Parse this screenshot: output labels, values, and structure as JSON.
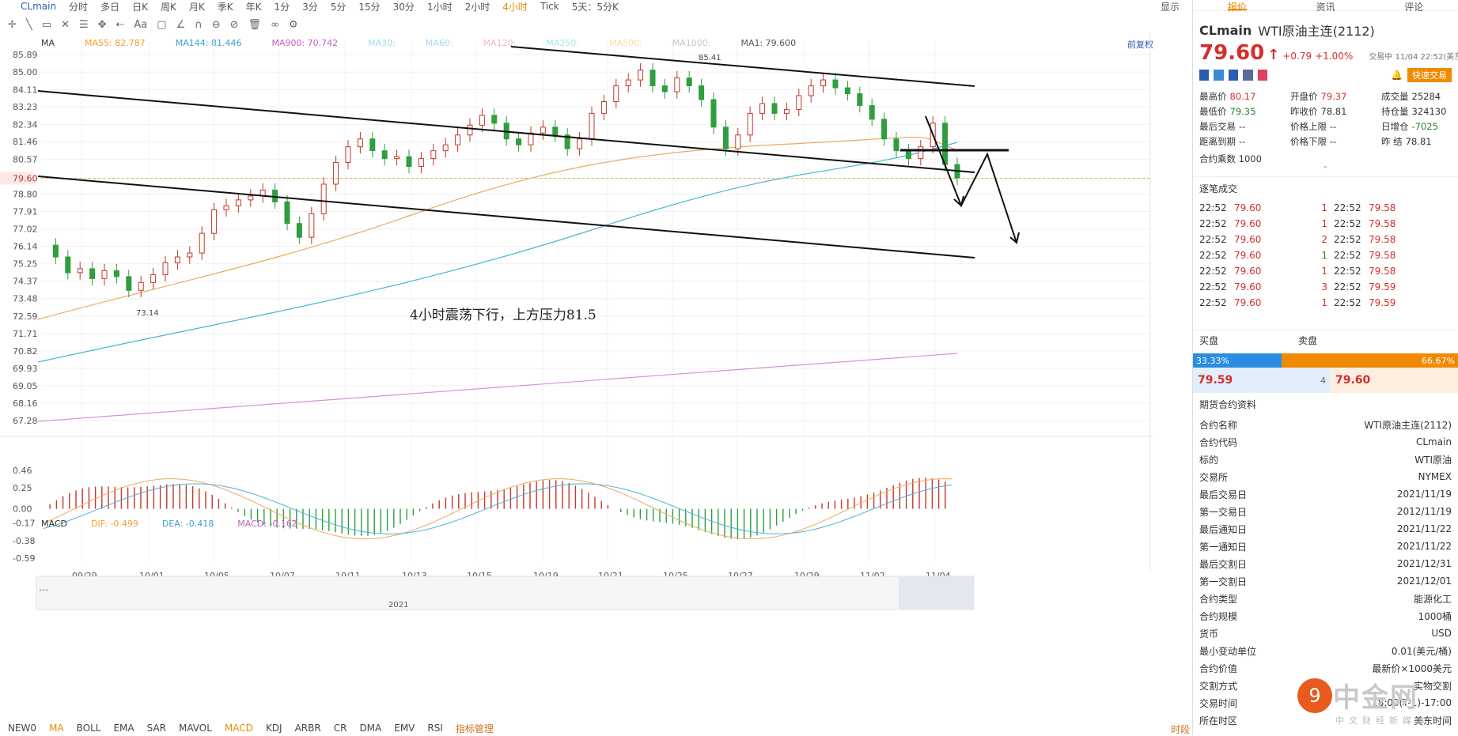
{
  "topbar": {
    "symbol": "CLmain",
    "periods": [
      "分时",
      "多日",
      "日K",
      "周K",
      "月K",
      "季K",
      "年K",
      "1分",
      "3分",
      "5分",
      "15分",
      "30分",
      "1小时",
      "2小时",
      "4小时",
      "Tick",
      "5天：5分K"
    ],
    "active_period": "4小时",
    "display": "显示"
  },
  "ma": {
    "label": "MA",
    "items": [
      {
        "text": "MA55: 82.787",
        "color": "#f0a030"
      },
      {
        "text": "MA144: 81.446",
        "color": "#3aa0d0"
      },
      {
        "text": "MA900: 70.742",
        "color": "#c060c0"
      },
      {
        "text": "MA30:",
        "color": "#a8d8e8"
      },
      {
        "text": "MA60:",
        "color": "#a8d8e8"
      },
      {
        "text": "MA120:",
        "color": "#f0b8c8"
      },
      {
        "text": "MA250:",
        "color": "#a8e8e8"
      },
      {
        "text": "MA500:",
        "color": "#f0e0a0"
      },
      {
        "text": "MA1000:",
        "color": "#c8c8c8"
      },
      {
        "text": "MA1: 79.600",
        "color": "#555555"
      }
    ],
    "adjust": "前复权"
  },
  "price_axis": [
    "85.89",
    "85.00",
    "84.11",
    "83.23",
    "82.34",
    "81.46",
    "80.57",
    "79.60",
    "78.80",
    "77.91",
    "77.02",
    "76.14",
    "75.25",
    "74.37",
    "73.48",
    "72.59",
    "71.71",
    "70.82",
    "69.93",
    "69.05",
    "68.16",
    "67.28"
  ],
  "current_price_label": "79.60",
  "annotations": {
    "high": "85.41",
    "low": "73.14",
    "comment": "4小时震荡下行，上方压力81.5"
  },
  "macd": {
    "label": "MACD",
    "dif": "DIF: -0.499",
    "dea": "DEA: -0.418",
    "macd": "MACD: -0.162",
    "axis": [
      "0.46",
      "0.25",
      "0.00",
      "-0.17",
      "-0.38",
      "-0.59"
    ]
  },
  "dates": [
    "09/29",
    "10/01",
    "10/05",
    "10/07",
    "10/11",
    "10/13",
    "10/15",
    "10/19",
    "10/21",
    "10/25",
    "10/27",
    "10/29",
    "11/02",
    "11/04"
  ],
  "overview_year": "2021",
  "indicators": [
    "NEW0",
    "MA",
    "BOLL",
    "EMA",
    "SAR",
    "MAVOL",
    "MACD",
    "KDJ",
    "ARBR",
    "CR",
    "DMA",
    "EMV",
    "RSI",
    "指标管理"
  ],
  "indicators_active": [
    "MA",
    "MACD"
  ],
  "bottom_right": "时段",
  "panel": {
    "tabs": [
      "报价",
      "资讯",
      "评论"
    ],
    "symbol": "CLmain",
    "name": "WTI原油主连(2112)",
    "price": "79.60",
    "change": "+0.79",
    "change_pct": "+1.00%",
    "status": "交易中 11/04 22:52(美东)",
    "quick_trade": "快速交易",
    "stats": [
      [
        "最高价",
        "80.17",
        "开盘价",
        "79.37",
        "成交量",
        "25284"
      ],
      [
        "最低价",
        "79.35",
        "昨收价",
        "78.81",
        "持仓量",
        "324130"
      ],
      [
        "最后交易",
        "--",
        "价格上限",
        "--",
        "日增仓",
        "-7025"
      ],
      [
        "距离到期",
        "--",
        "价格下限",
        "--",
        "昨  结",
        "78.81"
      ]
    ],
    "contract_mult": "合约乘数 1000",
    "trades_title": "逐笔成交",
    "trades": [
      [
        "22:52",
        "79.60",
        "1",
        "22:52",
        "79.58"
      ],
      [
        "22:52",
        "79.60",
        "1",
        "22:52",
        "79.58"
      ],
      [
        "22:52",
        "79.60",
        "2",
        "22:52",
        "79.58"
      ],
      [
        "22:52",
        "79.60",
        "1",
        "22:52",
        "79.58"
      ],
      [
        "22:52",
        "79.60",
        "1",
        "22:52",
        "79.58"
      ],
      [
        "22:52",
        "79.60",
        "3",
        "22:52",
        "79.59"
      ],
      [
        "22:52",
        "79.60",
        "1",
        "22:52",
        "79.59"
      ]
    ],
    "buy_label": "买盘",
    "sell_label": "卖盘",
    "buy_pct": "33.33%",
    "sell_pct": "66.67%",
    "bid": "79.59",
    "bid_qty": "4",
    "ask": "79.60",
    "info_title": "期货合约资料",
    "info": [
      [
        "合约名称",
        "WTI原油主连(2112)"
      ],
      [
        "合约代码",
        "CLmain"
      ],
      [
        "标的",
        "WTI原油"
      ],
      [
        "交易所",
        "NYMEX"
      ],
      [
        "最后交易日",
        "2021/11/19"
      ],
      [
        "第一交易日",
        "2012/11/19"
      ],
      [
        "最后通知日",
        "2021/11/22"
      ],
      [
        "第一通知日",
        "2021/11/22"
      ],
      [
        "最后交割日",
        "2021/12/31"
      ],
      [
        "第一交割日",
        "2021/12/01"
      ],
      [
        "合约类型",
        "能源化工"
      ],
      [
        "合约规模",
        "1000桶"
      ],
      [
        "货币",
        "USD"
      ],
      [
        "最小变动单位",
        "0.01(美元/桶)"
      ],
      [
        "合约价值",
        "最新价×1000美元"
      ],
      [
        "交割方式",
        "实物交割"
      ],
      [
        "交易时间",
        "18:00(T-1)-17:00"
      ],
      [
        "所在时区",
        "美东时间"
      ]
    ]
  },
  "watermark": {
    "main": "中金网",
    "sub": "中文财经新媒体",
    "logo": "9"
  }
}
